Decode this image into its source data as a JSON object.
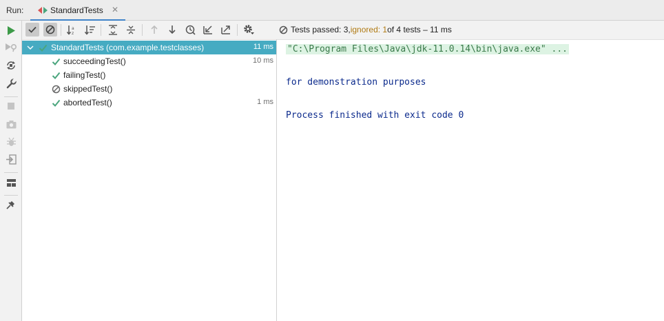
{
  "header": {
    "run_label": "Run:"
  },
  "tab": {
    "title": "StandardTests",
    "close": "✕"
  },
  "colors": {
    "accent": "#4083c9",
    "pass": "#4aa57d",
    "run": "#3c9a48",
    "selected_row": "#46abc2",
    "ignored": "#b07a12",
    "console_text": "#0b2a8c"
  },
  "sidebar": {
    "icons": [
      "rerun-icon",
      "rerun-failed-icon",
      "toggle-auto-test-icon",
      "settings-wrench-icon",
      "stop-icon",
      "screenshot-icon",
      "debug-icon",
      "exit-icon",
      "layout-icon",
      "pin-icon"
    ]
  },
  "toolbar": {
    "icons": [
      "show-passed-icon",
      "show-ignored-icon",
      "sort-alphabetically-icon",
      "sort-by-duration-icon",
      "expand-all-icon",
      "collapse-all-icon",
      "previous-failed-icon",
      "next-failed-icon",
      "test-history-icon",
      "import-tests-icon",
      "export-tests-icon",
      "settings-gear-icon"
    ]
  },
  "status": {
    "prefix": "Tests passed: 3, ",
    "ignored": "ignored: 1",
    "suffix": " of 4 tests – 11 ms"
  },
  "tree": {
    "root": {
      "label": "StandardTests (com.example.testclasses)",
      "duration": "11 ms",
      "state": "passed"
    },
    "children": [
      {
        "label": "succeedingTest()",
        "duration": "10 ms",
        "state": "passed"
      },
      {
        "label": "failingTest()",
        "duration": "",
        "state": "passed"
      },
      {
        "label": "skippedTest()",
        "duration": "",
        "state": "ignored"
      },
      {
        "label": "abortedTest()",
        "duration": "1 ms",
        "state": "passed"
      }
    ]
  },
  "console": {
    "lines": [
      "\"C:\\Program Files\\Java\\jdk-11.0.14\\bin\\java.exe\" ...",
      "for demonstration purposes",
      "Process finished with exit code 0"
    ]
  }
}
